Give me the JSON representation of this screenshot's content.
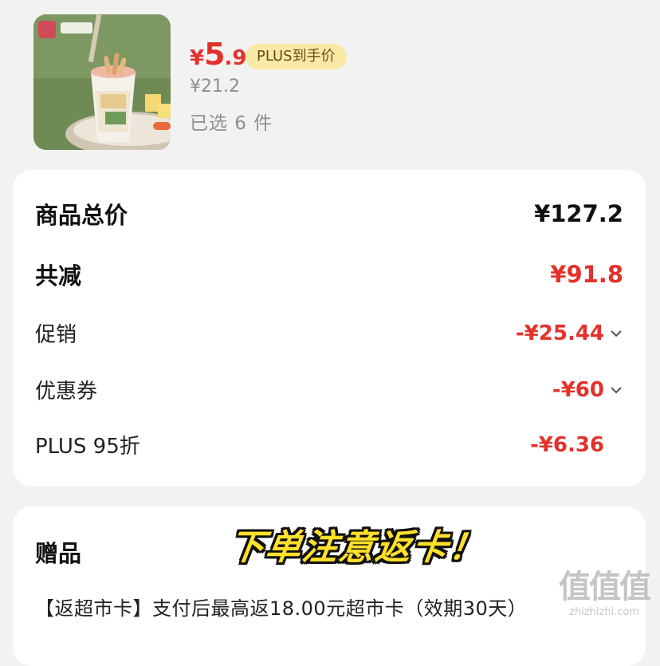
{
  "product": {
    "image_name": "yogurt-cup-product-photo",
    "price_symbol": "¥",
    "price_integer": "5",
    "price_decimal": ".9",
    "plus_tag": "PLUS到手价",
    "original_price": "¥21.2",
    "quantity_text": "已选 6 件"
  },
  "summary": {
    "total_label": "商品总价",
    "total_value": "¥127.2",
    "reduction_label": "共减",
    "reduction_value": "¥91.8",
    "items": [
      {
        "label": "促销",
        "value": "-¥25.44",
        "expandable": true
      },
      {
        "label": "优惠券",
        "value": "-¥60",
        "expandable": true
      },
      {
        "label": "PLUS 95折",
        "value": "-¥6.36",
        "expandable": false
      }
    ]
  },
  "gift": {
    "title": "赠品",
    "text": "【返超市卡】支付后最高返18.00元超市卡（效期30天）"
  },
  "overlay_text": "下单注意返卡！",
  "watermark": {
    "logo": "值值值",
    "url": "zhizhizhi.com"
  },
  "colors": {
    "accent_red": "#e4312b",
    "plus_tag_bg": "#f8e9a4",
    "overlay_yellow": "#ffe12a"
  }
}
